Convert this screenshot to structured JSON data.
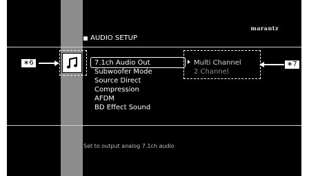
{
  "brand": "marantz",
  "setup_title": "AUDIO SETUP",
  "menu": [
    "7.1ch Audio Out",
    "Subwoofer Mode",
    "Source Direct",
    "Compression",
    "AFDM",
    "BD Effect Sound"
  ],
  "selected_index": 0,
  "submenu": [
    "Multi Channel",
    "2 Channel"
  ],
  "help_text": "Set to output analog 7.1ch audio",
  "callouts": {
    "left": "∗6",
    "right": "∗7"
  },
  "icon": "music-note-icon",
  "colors": {
    "screen": "#000000",
    "band": "#8c8c8c",
    "text": "#ffffff"
  }
}
